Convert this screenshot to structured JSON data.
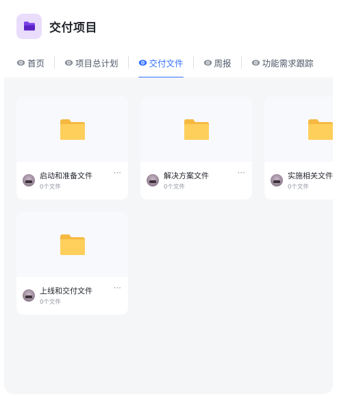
{
  "header": {
    "title": "交付项目",
    "icon": "folder-icon",
    "icon_bg": "#e9ddfb",
    "icon_color": "#7b3fe4"
  },
  "tabs": [
    {
      "label": "首页",
      "icon": "eye-icon",
      "active": false
    },
    {
      "label": "项目总计划",
      "icon": "eye-icon",
      "active": false
    },
    {
      "label": "交付文件",
      "icon": "eye-icon",
      "active": true
    },
    {
      "label": "周报",
      "icon": "eye-icon",
      "active": false
    },
    {
      "label": "功能需求跟踪",
      "icon": "eye-icon",
      "active": false
    }
  ],
  "accent_color": "#3370ff",
  "folders": [
    {
      "name": "启动和准备文件",
      "count": "0个文件",
      "more": "···"
    },
    {
      "name": "解决方案文件",
      "count": "0个文件",
      "more": "···"
    },
    {
      "name": "实施相关文件",
      "count": "0个文件",
      "more": "···"
    },
    {
      "name": "上线和交付文件",
      "count": "0个文件",
      "more": "···"
    }
  ],
  "folder_color": "#ffcf5c"
}
